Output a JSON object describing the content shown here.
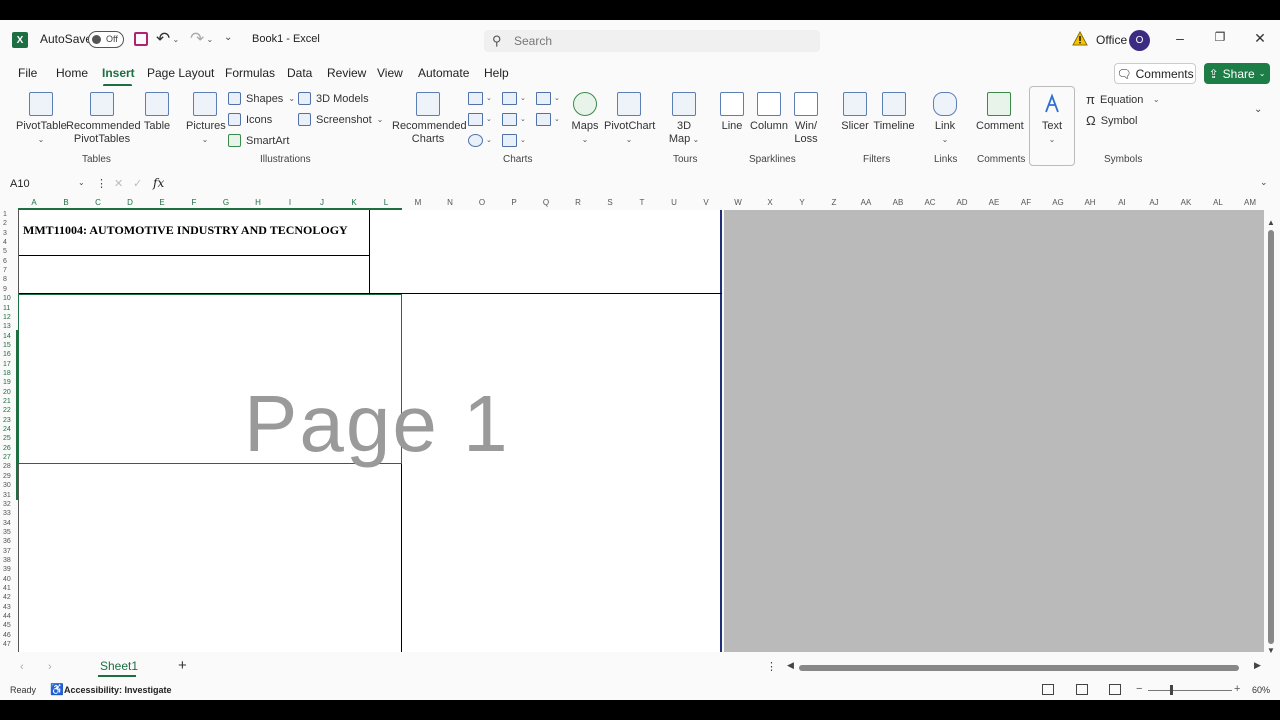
{
  "titlebar": {
    "app_logo": "X",
    "autosave_label": "AutoSave",
    "autosave_state": "Off",
    "document_title": "Book1  -  Excel",
    "search_placeholder": "Search",
    "account_label": "Office",
    "avatar_initial": "O"
  },
  "menu": {
    "tabs": [
      "File",
      "Home",
      "Insert",
      "Page Layout",
      "Formulas",
      "Data",
      "Review",
      "View",
      "Automate",
      "Help"
    ],
    "active_tab": "Insert",
    "comments_label": "Comments",
    "share_label": "Share"
  },
  "ribbon": {
    "tables": {
      "group_label": "Tables",
      "pivottable": "PivotTable",
      "recommended_pivot_1": "Recommended",
      "recommended_pivot_2": "PivotTables",
      "table": "Table"
    },
    "illustrations": {
      "group_label": "Illustrations",
      "pictures": "Pictures",
      "shapes": "Shapes",
      "icons": "Icons",
      "smartart": "SmartArt",
      "models_3d": "3D Models",
      "screenshot": "Screenshot"
    },
    "charts": {
      "group_label": "Charts",
      "recommended_1": "Recommended",
      "recommended_2": "Charts",
      "maps": "Maps",
      "pivotchart": "PivotChart"
    },
    "tours": {
      "group_label": "Tours",
      "map3d_1": "3D",
      "map3d_2": "Map"
    },
    "sparklines": {
      "group_label": "Sparklines",
      "line": "Line",
      "column": "Column",
      "winloss_1": "Win/",
      "winloss_2": "Loss"
    },
    "filters": {
      "group_label": "Filters",
      "slicer": "Slicer",
      "timeline": "Timeline"
    },
    "links": {
      "group_label": "Links",
      "link": "Link"
    },
    "comments": {
      "group_label": "Comments",
      "comment": "Comment"
    },
    "text": {
      "text": "Text"
    },
    "symbols": {
      "group_label": "Symbols",
      "equation": "Equation",
      "symbol": "Symbol"
    }
  },
  "formula_bar": {
    "name_box": "A10",
    "fx": "fx",
    "formula": ""
  },
  "grid": {
    "columns": [
      "A",
      "B",
      "C",
      "D",
      "E",
      "F",
      "G",
      "H",
      "I",
      "J",
      "K",
      "L",
      "M",
      "N",
      "O",
      "P",
      "Q",
      "R",
      "S",
      "T",
      "U",
      "V",
      "W",
      "X",
      "Y",
      "Z",
      "AA",
      "AB",
      "AC",
      "AD",
      "AE",
      "AF",
      "AG",
      "AH",
      "AI",
      "AJ",
      "AK",
      "AL",
      "AM"
    ],
    "rows": [
      "1",
      "2",
      "3",
      "4",
      "5",
      "6",
      "7",
      "8",
      "9",
      "10",
      "11",
      "12",
      "13",
      "14",
      "15",
      "16",
      "17",
      "18",
      "19",
      "20",
      "21",
      "22",
      "23",
      "24",
      "25",
      "26",
      "27",
      "28",
      "29",
      "30",
      "31",
      "32",
      "33",
      "34",
      "35",
      "36",
      "37",
      "38",
      "39",
      "40",
      "41",
      "42",
      "43",
      "44",
      "45",
      "46",
      "47"
    ],
    "heading_text": "MMT11004: AUTOMOTIVE INDUSTRY AND TECNOLOGY",
    "page_watermark": "Page 1"
  },
  "sheets": {
    "tabs": [
      "Sheet1"
    ],
    "active": "Sheet1"
  },
  "statusbar": {
    "ready": "Ready",
    "accessibility": "Accessibility: Investigate",
    "zoom": "60%"
  },
  "colors": {
    "excel_green": "#1d6f42",
    "share_green": "#1d7d46",
    "page_border": "#1f2f7a",
    "offpage_gray": "#bababa",
    "avatar": "#3c2a83"
  }
}
